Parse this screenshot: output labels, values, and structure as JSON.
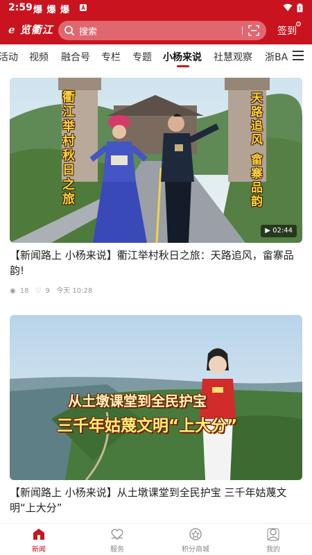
{
  "status_bar": {
    "time": "2:59",
    "notification_glyphs": "爆 爆 爆"
  },
  "header": {
    "logo_text": "e 览衢江",
    "search_placeholder": "搜索",
    "signin_label": "签到"
  },
  "colors": {
    "brand_red": "#c9141f",
    "search_bg": "#e06770"
  },
  "tabs": [
    {
      "label": "活动"
    },
    {
      "label": "视频"
    },
    {
      "label": "融合号"
    },
    {
      "label": "专栏"
    },
    {
      "label": "专题"
    },
    {
      "label": "小杨来说",
      "active": true
    },
    {
      "label": "社慧观察"
    },
    {
      "label": "浙BA"
    }
  ],
  "feed": {
    "items": [
      {
        "overlay_vertical_left": "衢江举村秋日之旅",
        "overlay_vertical_right": "天路追风 畲寨品韵",
        "duration": "02:44",
        "title": "【新闻路上 小杨来说】衢江举村秋日之旅：天路追风，畲寨品韵!",
        "views": "18",
        "likes": "9",
        "time": "今天 10:28"
      },
      {
        "overlay_line1": "从土墩课堂到全民护宝",
        "overlay_line2": "三千年姑蔑文明“上大分”",
        "title": "【新闻路上 小杨来说】从土墩课堂到全民护宝 三千年姑蔑文明“上大分”"
      }
    ]
  },
  "bottom_nav": [
    {
      "label": "新闻",
      "icon": "news-icon",
      "active": true
    },
    {
      "label": "服务",
      "icon": "heart-hand-icon"
    },
    {
      "label": "积分商城",
      "icon": "points-mall-icon"
    },
    {
      "label": "我的",
      "icon": "profile-icon"
    }
  ]
}
